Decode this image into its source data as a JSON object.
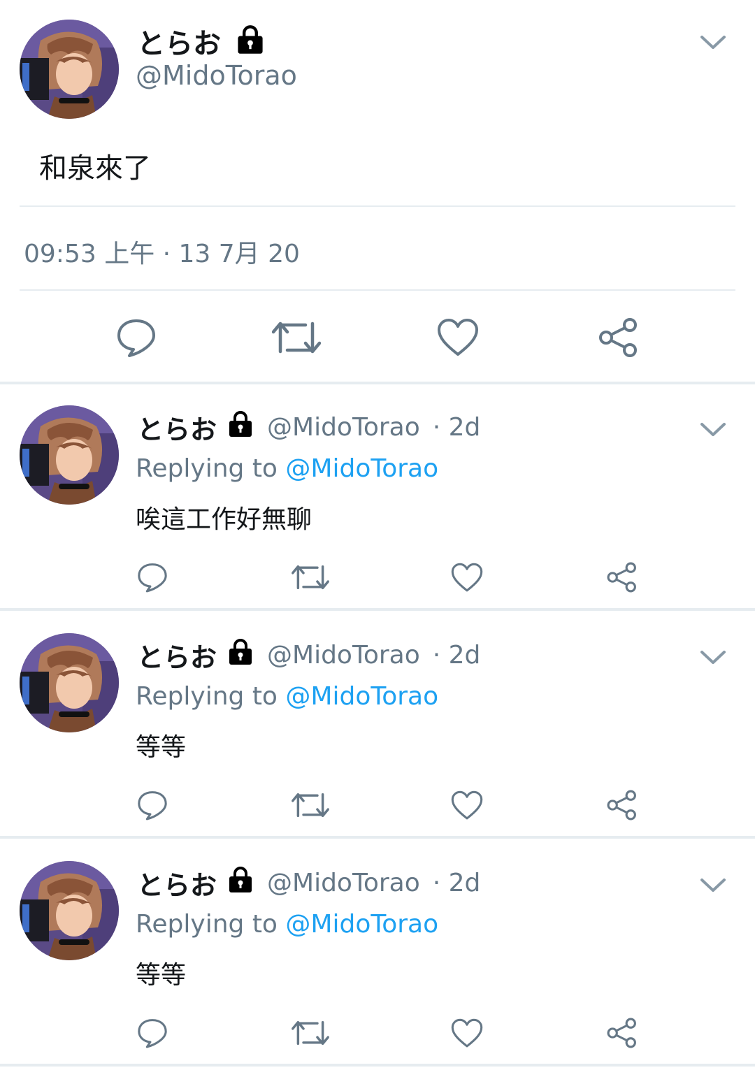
{
  "main_tweet": {
    "display_name": "とらお",
    "handle": "@MidoTorao",
    "text": "和泉來了",
    "timestamp": "09:53 上午 · 13 7月 20",
    "icons": {
      "lock": "lock-icon",
      "menu": "chevron-down-icon",
      "reply": "reply-icon",
      "retweet": "retweet-icon",
      "like": "heart-icon",
      "share": "share-icon"
    }
  },
  "replies": [
    {
      "display_name": "とらお",
      "handle": "@MidoTorao",
      "age": "· 2d",
      "replying_prefix": "Replying to",
      "replying_handle": "@MidoTorao",
      "text": "唉這工作好無聊"
    },
    {
      "display_name": "とらお",
      "handle": "@MidoTorao",
      "age": "· 2d",
      "replying_prefix": "Replying to",
      "replying_handle": "@MidoTorao",
      "text": "等等"
    },
    {
      "display_name": "とらお",
      "handle": "@MidoTorao",
      "age": "· 2d",
      "replying_prefix": "Replying to",
      "replying_handle": "@MidoTorao",
      "text": "等等"
    }
  ],
  "colors": {
    "text_primary": "#14171a",
    "text_secondary": "#657786",
    "link": "#1da1f2",
    "divider": "#e6ecf0",
    "icon": "#657786"
  }
}
